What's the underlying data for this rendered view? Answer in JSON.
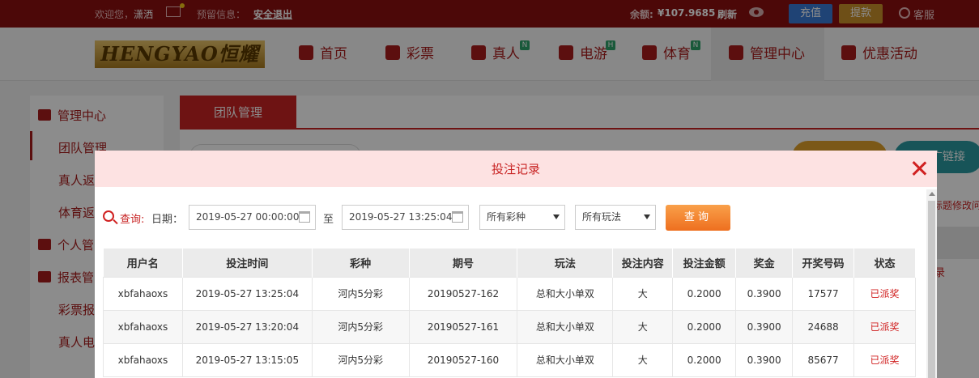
{
  "topbar": {
    "welcome_prefix": "欢迎您，",
    "username": "潇洒",
    "notice_label": "预留信息：",
    "logout": "安全退出",
    "balance_label": "余额:",
    "balance_value": "¥107.9685",
    "refresh": "刷新",
    "deposit": "充值",
    "withdraw": "提款",
    "service": "客服"
  },
  "logo": "HENGYAO恒耀",
  "nav": [
    {
      "label": "首页",
      "badge": ""
    },
    {
      "label": "彩票",
      "badge": ""
    },
    {
      "label": "真人",
      "badge": "N"
    },
    {
      "label": "电游",
      "badge": "H"
    },
    {
      "label": "体育",
      "badge": "N"
    },
    {
      "label": "管理中心",
      "badge": ""
    },
    {
      "label": "优惠活动",
      "badge": ""
    }
  ],
  "sidebar": {
    "group1": "管理中心",
    "items1": [
      "团队管理",
      "真人返",
      "体育返"
    ],
    "group2": "个人管",
    "group3": "报表管",
    "items3": [
      "彩票报",
      "真人电"
    ]
  },
  "main": {
    "tab": "团队管理",
    "promo_btn": "广链接",
    "hint": "际题修改问",
    "rec": "录"
  },
  "modal": {
    "title": "投注记录",
    "query_label": "查询:",
    "date_label": "日期：",
    "date_from": "2019-05-27 00:00:00",
    "to_label": "至",
    "date_to": "2019-05-27 13:25:04",
    "lottery_select": "所有彩种",
    "play_select": "所有玩法",
    "query_button": "查询",
    "columns": [
      "用户名",
      "投注时间",
      "彩种",
      "期号",
      "玩法",
      "投注内容",
      "投注金额",
      "奖金",
      "开奖号码",
      "状态"
    ],
    "rows": [
      [
        "xbfahaoxs",
        "2019-05-27 13:25:04",
        "河内5分彩",
        "20190527-162",
        "总和大小单双",
        "大",
        "0.2000",
        "0.3900",
        "17577",
        "已派奖"
      ],
      [
        "xbfahaoxs",
        "2019-05-27 13:20:04",
        "河内5分彩",
        "20190527-161",
        "总和大小单双",
        "大",
        "0.2000",
        "0.3900",
        "24688",
        "已派奖"
      ],
      [
        "xbfahaoxs",
        "2019-05-27 13:15:05",
        "河内5分彩",
        "20190527-160",
        "总和大小单双",
        "大",
        "0.2000",
        "0.3900",
        "85677",
        "已派奖"
      ]
    ]
  }
}
